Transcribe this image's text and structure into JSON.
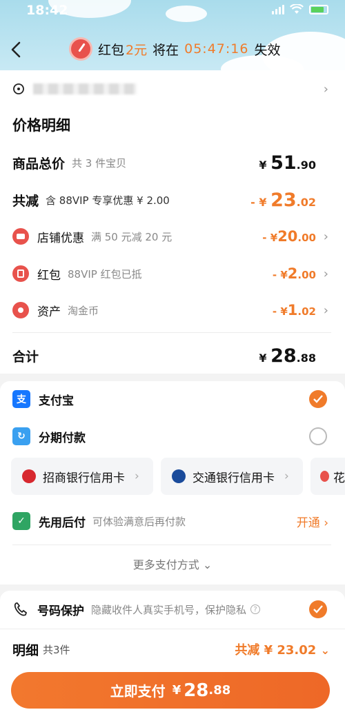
{
  "status_bar": {
    "time": "18:42"
  },
  "header": {
    "redpacket_label": "红包",
    "redpacket_amount": "2元",
    "expire_prefix": "将在",
    "countdown": "05:47:16",
    "expire_suffix": "失效"
  },
  "price_detail": {
    "title": "价格明细",
    "total": {
      "label": "商品总价",
      "note": "共 3 件宝贝",
      "yen": "¥",
      "int": "51",
      "dec": ".90"
    },
    "discount": {
      "label": "共减",
      "note": "含 88VIP 专享优惠 ¥ 2.00",
      "prefix": "- ¥",
      "int": "23",
      "dec": ".02"
    },
    "items": [
      {
        "label": "店铺优惠",
        "note": "满 50 元减 20 元",
        "prefix": "- ¥",
        "int": "20",
        "dec": ".00",
        "icon": "store-coupon-icon",
        "color": "#e8524c"
      },
      {
        "label": "红包",
        "note": "88VIP 红包已抵",
        "prefix": "- ¥",
        "int": "2",
        "dec": ".00",
        "icon": "redpacket-icon",
        "color": "#e8524c"
      },
      {
        "label": "资产",
        "note": "淘金币",
        "prefix": "- ¥",
        "int": "1",
        "dec": ".02",
        "icon": "coin-tag-icon",
        "color": "#e8524c"
      }
    ],
    "sum": {
      "label": "合计",
      "yen": "¥",
      "int": "28",
      "dec": ".88"
    }
  },
  "payment": {
    "alipay": "支付宝",
    "installment": "分期付款",
    "banks": [
      {
        "name": "招商银行信用卡",
        "color": "#d7282f"
      },
      {
        "name": "交通银行信用卡",
        "color": "#1a4b9b"
      },
      {
        "name": "花",
        "color": "#e8524c"
      }
    ],
    "bnpl": {
      "label": "先用后付",
      "note": "可体验满意后再付款",
      "action": "开通"
    },
    "more": "更多支付方式"
  },
  "privacy": {
    "label": "号码保护",
    "note": "隐藏收件人真实手机号，保护隐私"
  },
  "footer": {
    "detail_label": "明细",
    "detail_count": "共3件",
    "discount_summary": "共减 ¥ 23.02",
    "pay_label": "立即支付",
    "pay_yen": "¥",
    "pay_int": "28",
    "pay_dec": ".88"
  },
  "colors": {
    "accent": "#f07b2a",
    "alipay": "#1677ff",
    "green": "#2fa563"
  }
}
